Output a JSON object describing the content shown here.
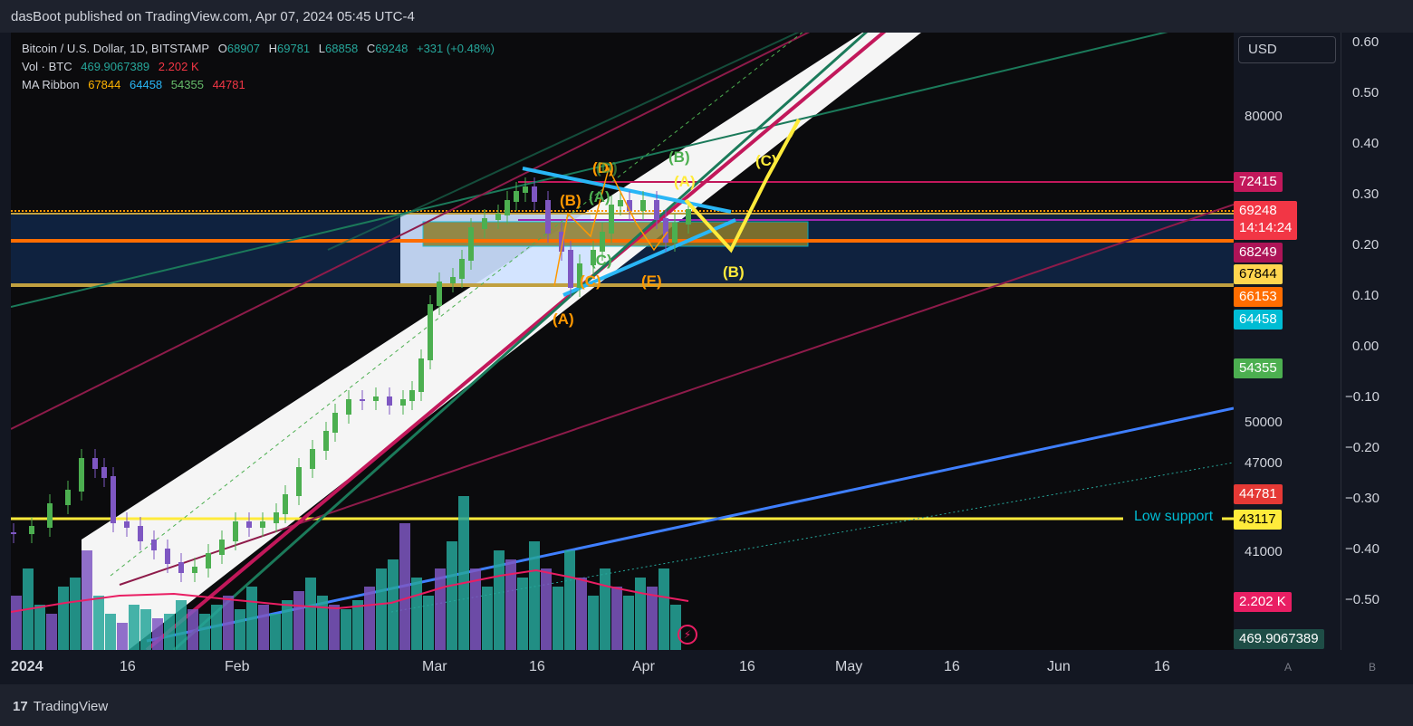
{
  "header": {
    "published_by": "dasBoot published on TradingView.com, Apr 07, 2024 05:45 UTC-4"
  },
  "legend": {
    "symbol": "Bitcoin / U.S. Dollar, 1D, BITSTAMP",
    "o_label": "O",
    "o_value": "68907",
    "h_label": "H",
    "h_value": "69781",
    "l_label": "L",
    "l_value": "68858",
    "c_label": "C",
    "c_value": "69248",
    "change": "+331 (+0.48%)",
    "vol_label": "Vol · BTC",
    "vol_value": "469.9067389",
    "vol_ma": "2.202 K",
    "ma_label": "MA Ribbon",
    "ma_values": [
      "67844",
      "64458",
      "54355",
      "44781"
    ]
  },
  "colors": {
    "bg": "#0b0b0d",
    "green": "#4caf50",
    "purple": "#7e57c2",
    "teal": "#26a69a",
    "crimson": "#c2185b",
    "orange": "#ff6d00",
    "yellow": "#ffeb3b",
    "cyan": "#00bcd4",
    "blue": "#3f7fff"
  },
  "currency": "USD",
  "price_axis": [
    "80000",
    "50000",
    "47000",
    "41000"
  ],
  "secondary_axis": [
    "0.60",
    "0.50",
    "0.40",
    "0.30",
    "0.20",
    "0.10",
    "0.00",
    "−0.10",
    "−0.20",
    "−0.30",
    "−0.40",
    "−0.50"
  ],
  "price_tags": {
    "t72415": "72415",
    "last_price": "69248",
    "countdown": "14:14:24",
    "t68249": "68249",
    "t67844": "67844",
    "t66153": "66153",
    "t64458": "64458",
    "t54355": "54355",
    "t44781": "44781",
    "t43117": "43117",
    "vol_ma": "2.202 K",
    "vol": "469.9067389"
  },
  "annotations": {
    "low_support": "Low support"
  },
  "time_axis": [
    "2024",
    "16",
    "Feb",
    "Mar",
    "16",
    "Apr",
    "16",
    "May",
    "16",
    "Jun",
    "16"
  ],
  "scale_buttons": [
    "A",
    "B"
  ],
  "waves": {
    "A1": "(A)",
    "B1": "(B)",
    "C1": "(C)",
    "D1": "(D)",
    "E1": "(E)",
    "Bg": "(B)",
    "Cg": "(C)",
    "Dg": "(D)",
    "Ag": "(A)",
    "Ay": "(A)",
    "By": "(B)",
    "Cy": "(C)"
  },
  "footer": {
    "brand": "TradingView"
  }
}
